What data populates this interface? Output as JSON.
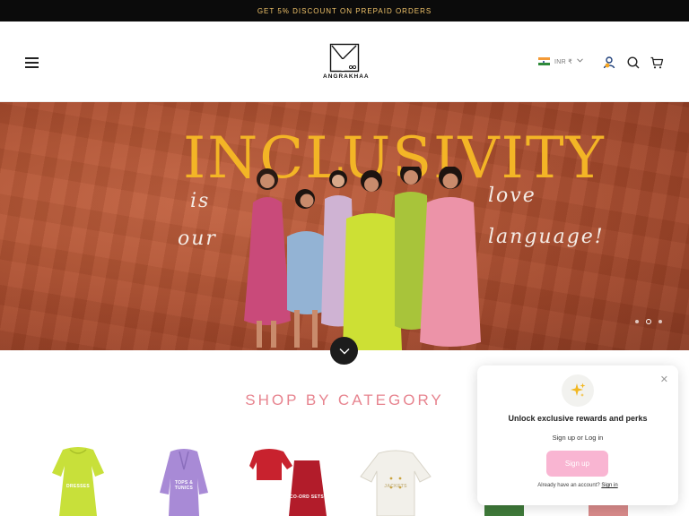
{
  "announcement": {
    "text": "GET 5% DISCOUNT ON PREPAID ORDERS"
  },
  "header": {
    "brand": "ANGRAKHAA",
    "currency": {
      "label": "INR ₹",
      "flag": "india-flag"
    }
  },
  "hero": {
    "title": "INCLUSIVITY",
    "script_left": [
      "is",
      "our"
    ],
    "script_right": [
      "love",
      "language!"
    ],
    "slides": {
      "count": 3,
      "active": 2
    }
  },
  "category": {
    "title": "SHOP BY CATEGORY",
    "items": [
      {
        "label": "DRESSES"
      },
      {
        "label": "TOPS & TUNICS"
      },
      {
        "label": "CO-ORD SETS"
      },
      {
        "label": "JACKETS"
      }
    ]
  },
  "popup": {
    "heading": "Unlock exclusive rewards and perks",
    "subtext": "Sign up or Log in",
    "button": "Sign up",
    "footer_text": "Already have an account?",
    "footer_link": "Sign in"
  },
  "colors": {
    "accent_gold": "#f3b526",
    "category_pink": "#e7848f",
    "popup_button": "#f9b5d2",
    "hero_bg": "#b45534"
  }
}
